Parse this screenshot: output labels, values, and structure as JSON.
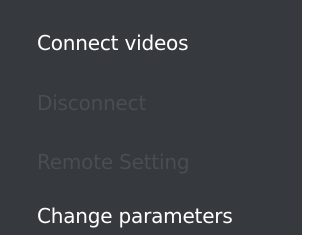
{
  "context_menu": {
    "items": [
      {
        "label": "Connect videos",
        "enabled": true
      },
      {
        "label": "Disconnect",
        "enabled": false
      },
      {
        "label": "Remote Setting",
        "enabled": false
      },
      {
        "label": "Change parameters",
        "enabled": true
      }
    ],
    "colors": {
      "background": "#36393e",
      "enabled_text": "#ffffff",
      "disabled_text": "#4a4d52"
    }
  }
}
